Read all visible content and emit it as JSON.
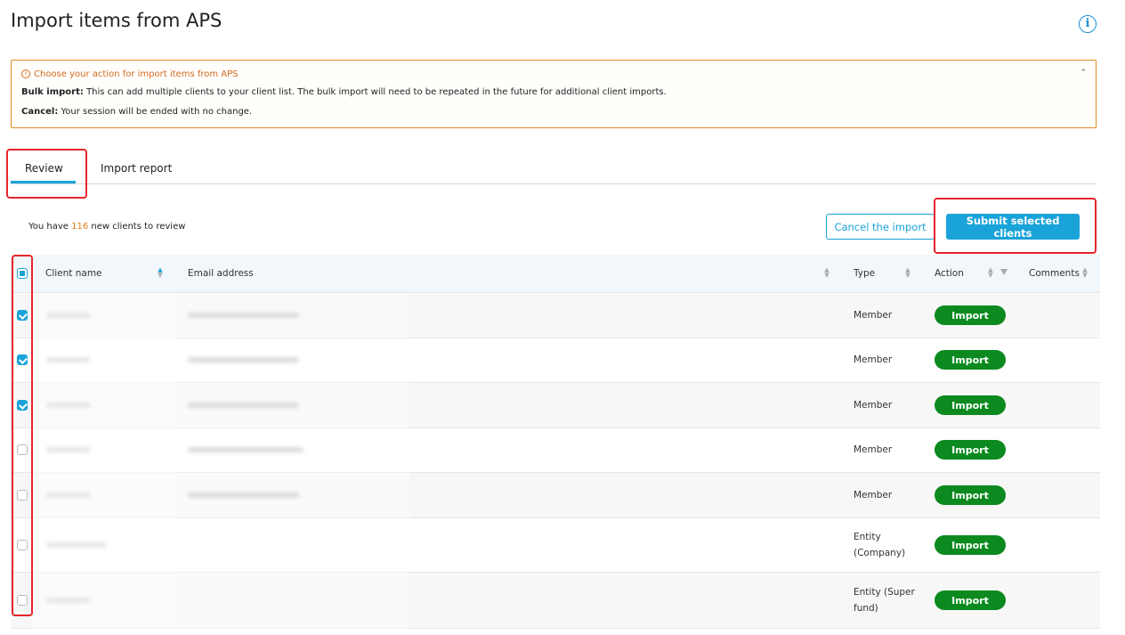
{
  "page": {
    "title": "Import items from APS"
  },
  "alert": {
    "title": "Choose your action for import items from APS",
    "bulk_label": "Bulk import:",
    "bulk_text": " This can add multiple clients to your client list. The bulk import will need to be repeated in the future for additional client imports.",
    "cancel_label": "Cancel:",
    "cancel_text": " Your session will be ended with no change.",
    "warning_glyph": "!",
    "collapse_glyph": "⌃"
  },
  "tabs": [
    {
      "label": "Review",
      "active": true
    },
    {
      "label": "Import report",
      "active": false
    }
  ],
  "summary": {
    "prefix": "You have ",
    "count": "116",
    "suffix": " new clients to review"
  },
  "buttons": {
    "cancel": "Cancel the import",
    "submit": "Submit selected clients"
  },
  "table": {
    "columns": [
      "Client name",
      "Email address",
      "Type",
      "Action",
      "Comments"
    ],
    "rows": [
      {
        "checked": true,
        "type": "Member",
        "action": "Import"
      },
      {
        "checked": true,
        "type": "Member",
        "action": "Import"
      },
      {
        "checked": true,
        "type": "Member",
        "action": "Import"
      },
      {
        "checked": false,
        "type": "Member",
        "action": "Import"
      },
      {
        "checked": false,
        "type": "Member",
        "action": "Import"
      },
      {
        "checked": false,
        "type": "Entity (Company)",
        "action": "Import"
      },
      {
        "checked": false,
        "type": "Entity (Super fund)",
        "action": "Import"
      }
    ]
  },
  "colors": {
    "accent": "#1aa3d9",
    "import_green": "#0c8a1f",
    "warning": "#e08a1e",
    "highlight": "#e8242c"
  }
}
